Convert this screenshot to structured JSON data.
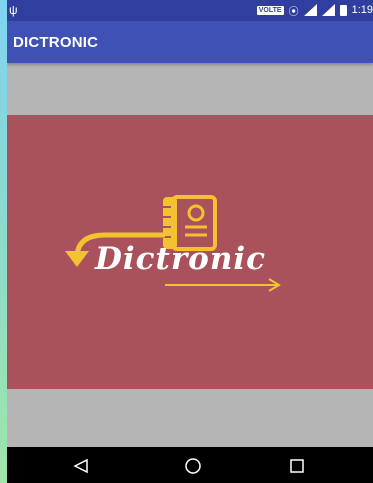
{
  "status_bar": {
    "volte": "VOLTE",
    "time": "1:19"
  },
  "app_bar": {
    "title": "DICTRONIC"
  },
  "splash": {
    "logo_text": "Dictronic"
  },
  "colors": {
    "status_bar": "#303f9f",
    "app_bar": "#3f51b5",
    "splash_background": "#aa525c",
    "logo_accent": "#f2c230",
    "background": "#b5b5b5",
    "nav_bar": "#000000"
  },
  "icons": {
    "status": [
      "usb-icon",
      "vibrate-icon",
      "signal-icon",
      "signal-icon",
      "battery-icon"
    ],
    "logo": "dictionary-book-icon",
    "nav": [
      "back-icon",
      "home-icon",
      "recents-icon"
    ]
  }
}
